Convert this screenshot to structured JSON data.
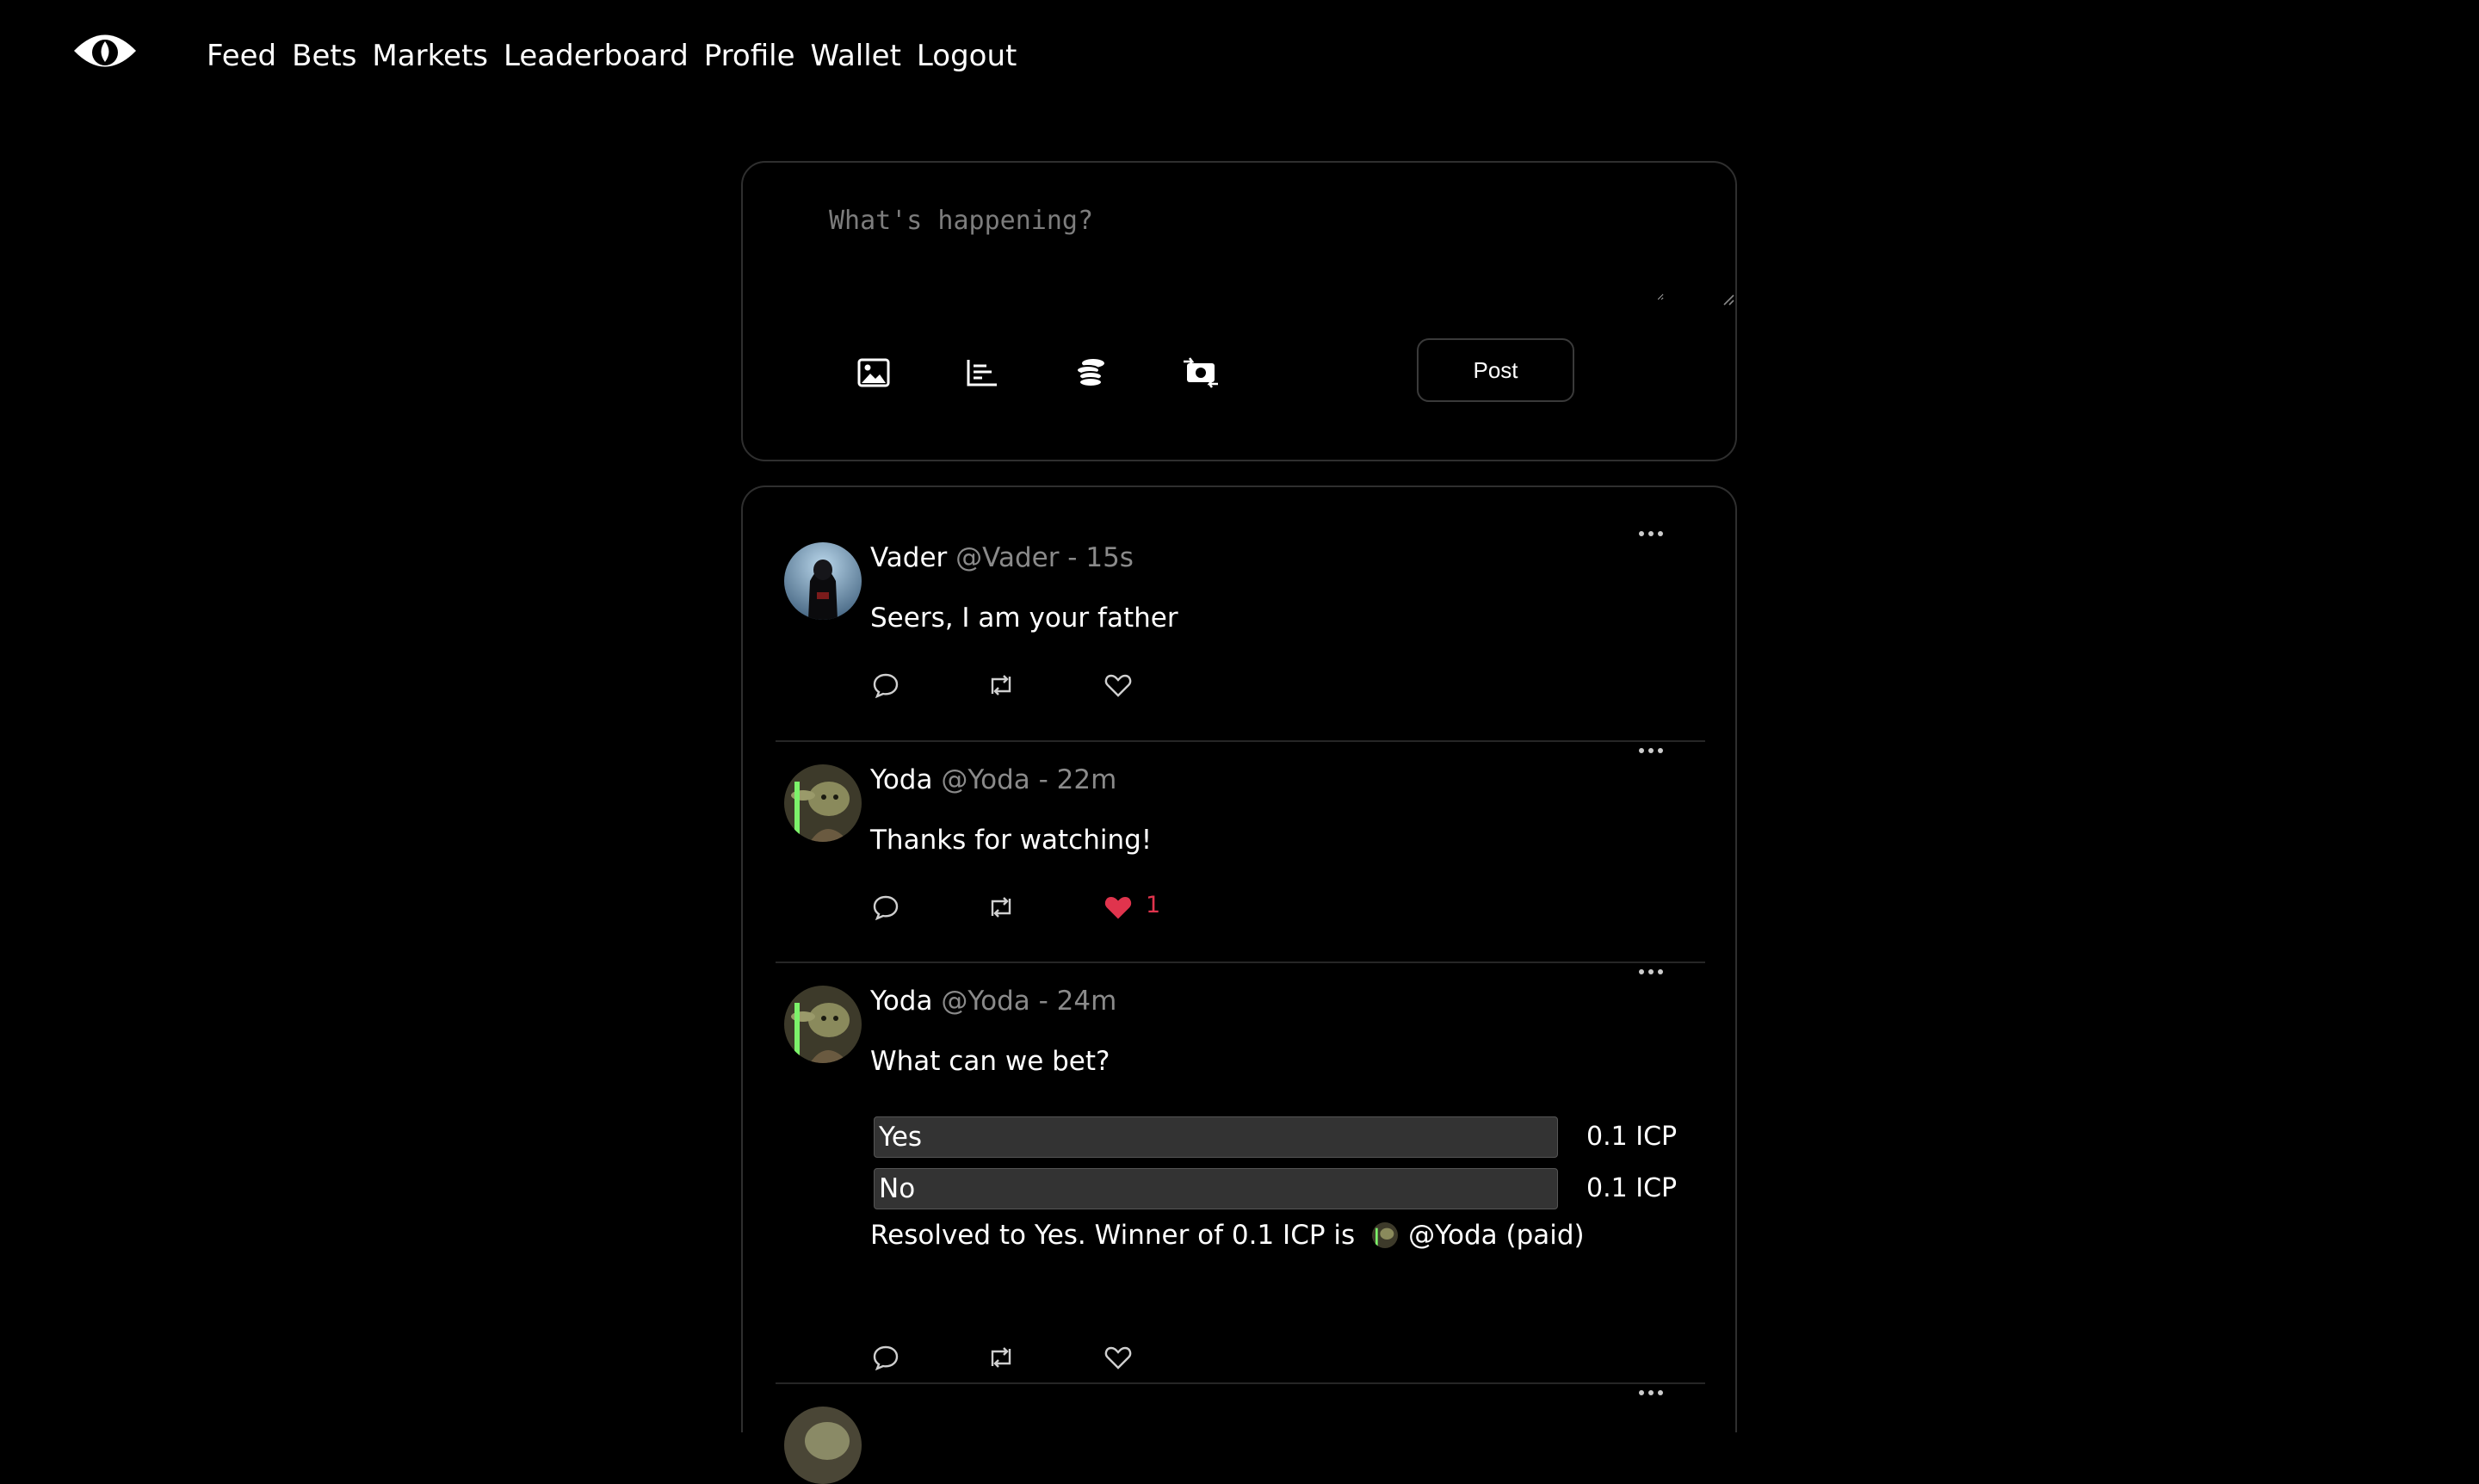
{
  "nav": {
    "logo": "eye-logo",
    "items": [
      "Feed",
      "Bets",
      "Markets",
      "Leaderboard",
      "Profile",
      "Wallet",
      "Logout"
    ]
  },
  "composer": {
    "placeholder": "What's happening?",
    "tools": [
      "image-icon",
      "poll-chart-icon",
      "coins-icon",
      "exchange-icon"
    ],
    "post_label": "Post"
  },
  "colors": {
    "background": "#000000",
    "border": "#2f2f2f",
    "muted_text": "#8a8a8a",
    "like_red": "#e0344d",
    "option_bg": "#333333"
  },
  "posts": [
    {
      "name": "Vader",
      "meta": "@Vader - 15s",
      "text": "Seers, I am your father",
      "liked": false,
      "like_count": ""
    },
    {
      "name": "Yoda",
      "meta": "@Yoda - 22m",
      "text": "Thanks for watching!",
      "liked": true,
      "like_count": "1"
    },
    {
      "name": "Yoda",
      "meta": "@Yoda - 24m",
      "text": "What can we bet?",
      "liked": false,
      "like_count": "",
      "bet": {
        "options": [
          {
            "label": "Yes",
            "amount": "0.1 ICP"
          },
          {
            "label": "No",
            "amount": "0.1 ICP"
          }
        ],
        "resolution_prefix": "Resolved to Yes. Winner of 0.1 ICP is",
        "winner": "@Yoda (paid)"
      }
    }
  ]
}
